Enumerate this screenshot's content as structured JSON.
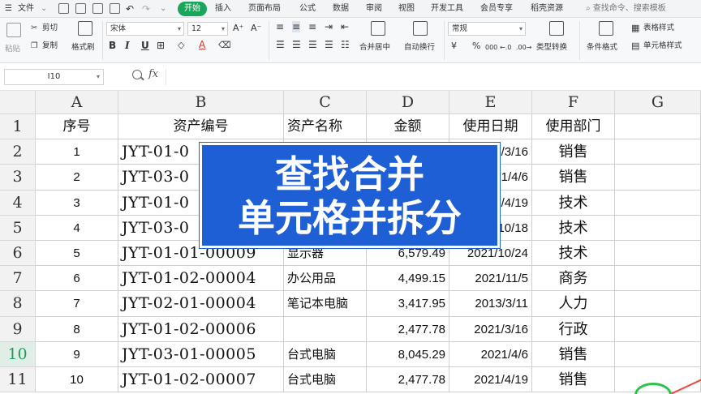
{
  "menubar": {
    "file_label": "文件",
    "tabs": [
      "开始",
      "插入",
      "页面布局",
      "公式",
      "数据",
      "审阅",
      "视图",
      "开发工具",
      "会员专享",
      "稻壳资源"
    ],
    "search_placeholder": "查找命令、搜索模板"
  },
  "ribbon": {
    "paste_label": "粘贴",
    "cut_label": "剪切",
    "copy_label": "复制",
    "format_painter_label": "格式刷",
    "font_name": "宋体",
    "font_size": "12",
    "bold": "B",
    "italic": "I",
    "underline": "U",
    "font_grow": "A⁺",
    "font_shrink": "A⁻",
    "merge_label": "合并居中",
    "wrap_label": "自动换行",
    "number_format": "常规",
    "currency_symbol": "¥",
    "percent_symbol": "%",
    "thousands_symbol": "000",
    "dec_inc": "←.0",
    "dec_dec": ".00→",
    "type_convert_label": "类型转换",
    "conditional_format_label": "条件格式",
    "table_style_label": "表格样式",
    "cell_style_label": "单元格样式"
  },
  "formula_bar": {
    "cell_ref": "I10",
    "fx_label": "fx",
    "formula": ""
  },
  "grid": {
    "columns": [
      "A",
      "B",
      "C",
      "D",
      "E",
      "F",
      "G"
    ],
    "rows": [
      "1",
      "2",
      "3",
      "4",
      "5",
      "6",
      "7",
      "8",
      "9",
      "10",
      "11"
    ],
    "selected_row": "10",
    "headers": [
      "序号",
      "资产编号",
      "资产名称",
      "金额",
      "使用日期",
      "使用部门"
    ],
    "data": [
      {
        "no": "1",
        "code": "JYT-01-0",
        "name": "",
        "amount": "",
        "date": "1/3/16",
        "dept": "销售"
      },
      {
        "no": "2",
        "code": "JYT-03-0",
        "name": "",
        "amount": "",
        "date": "21/4/6",
        "dept": "销售"
      },
      {
        "no": "3",
        "code": "JYT-01-0",
        "name": "",
        "amount": "",
        "date": "1/4/19",
        "dept": "技术"
      },
      {
        "no": "4",
        "code": "JYT-03-0",
        "name": "",
        "amount": "",
        "date": "10/18",
        "dept": "技术"
      },
      {
        "no": "5",
        "code": "JYT-01-01-00009",
        "name": "显示器",
        "amount": "6,579.49",
        "date": "2021/10/24",
        "dept": "技术"
      },
      {
        "no": "6",
        "code": "JYT-01-02-00004",
        "name": "办公用品",
        "amount": "4,499.15",
        "date": "2021/11/5",
        "dept": "商务"
      },
      {
        "no": "7",
        "code": "JYT-02-01-00004",
        "name": "笔记本电脑",
        "amount": "3,417.95",
        "date": "2013/3/11",
        "dept": "人力"
      },
      {
        "no": "8",
        "code": "JYT-01-02-00006",
        "name": "",
        "amount": "2,477.78",
        "date": "2021/3/16",
        "dept": "行政"
      },
      {
        "no": "9",
        "code": "JYT-03-01-00005",
        "name": "台式电脑",
        "amount": "8,045.29",
        "date": "2021/4/6",
        "dept": "销售"
      },
      {
        "no": "10",
        "code": "JYT-01-02-00007",
        "name": "台式电脑",
        "amount": "2,477.78",
        "date": "2021/4/19",
        "dept": "销售"
      }
    ]
  },
  "overlay": {
    "line1": "查找合并",
    "line2": "单元格并拆分"
  },
  "colors": {
    "accent_green": "#1aa65a",
    "banner_blue": "#1f5fd6",
    "selected_row_text": "#1f9a5a"
  }
}
